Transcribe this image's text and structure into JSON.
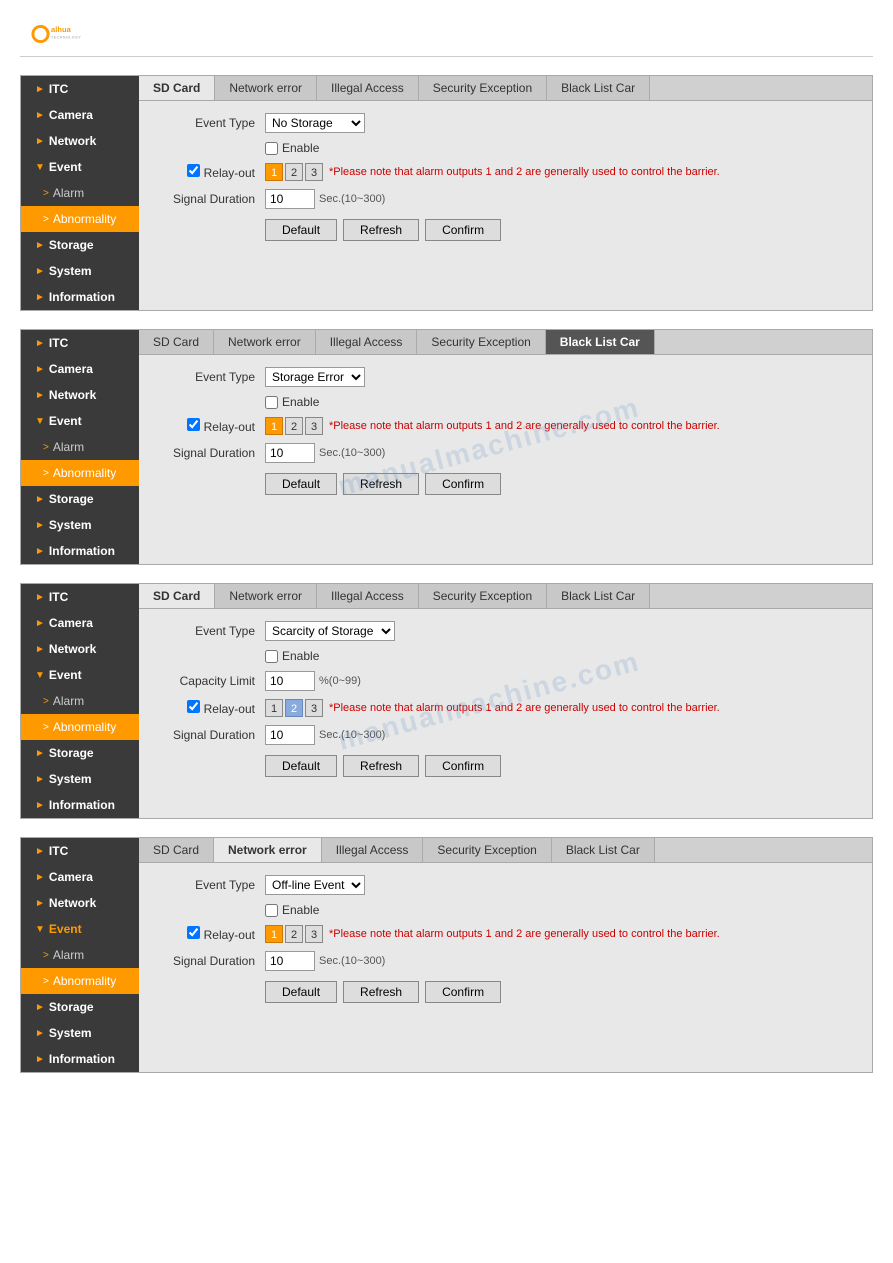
{
  "logo": {
    "alt": "Dahua Technology"
  },
  "panels": [
    {
      "id": "panel1",
      "tabs": [
        {
          "label": "SD Card",
          "active": false
        },
        {
          "label": "Network error",
          "active": false
        },
        {
          "label": "Illegal Access",
          "active": false
        },
        {
          "label": "Security Exception",
          "active": false
        },
        {
          "label": "Black List Car",
          "active": false
        }
      ],
      "activeTab": "SD Card",
      "sidebar": [
        {
          "label": "ITC",
          "type": "section",
          "arrow": "►"
        },
        {
          "label": "Camera",
          "type": "section",
          "arrow": "►"
        },
        {
          "label": "Network",
          "type": "section",
          "arrow": "►"
        },
        {
          "label": "Event",
          "type": "section",
          "arrow": "▼"
        },
        {
          "label": "Alarm",
          "type": "sub",
          "arrow": ">"
        },
        {
          "label": "Abnormality",
          "type": "sub-active",
          "arrow": ">"
        },
        {
          "label": "Storage",
          "type": "section",
          "arrow": "►"
        },
        {
          "label": "System",
          "type": "section",
          "arrow": "►"
        },
        {
          "label": "Information",
          "type": "section",
          "arrow": "►"
        }
      ],
      "form": {
        "eventTypeLabel": "Event Type",
        "eventTypeValue": "No Storage",
        "eventTypeOptions": [
          "No Storage",
          "Storage Error",
          "Scarcity of Storage Space",
          "Off-line Event"
        ],
        "enableLabel": "Enable",
        "enableChecked": false,
        "relayOutLabel": "Relay-out",
        "relayBtns": [
          "1",
          "2",
          "3"
        ],
        "relaySelected": 0,
        "relayNote": "*Please note that alarm outputs 1 and 2 are generally used to control the barrier.",
        "signalDurationLabel": "Signal Duration",
        "signalDurationValue": "10",
        "signalDurationHint": "Sec.(10~300)",
        "defaultBtn": "Default",
        "refreshBtn": "Refresh",
        "confirmBtn": "Confirm"
      },
      "watermark": false
    },
    {
      "id": "panel2",
      "tabs": [
        {
          "label": "SD Card",
          "active": false
        },
        {
          "label": "Network error",
          "active": false
        },
        {
          "label": "Illegal Access",
          "active": false
        },
        {
          "label": "Security Exception",
          "active": false
        },
        {
          "label": "Black List Car",
          "active": true
        }
      ],
      "activeTab": "Black List Car",
      "sidebar": [
        {
          "label": "ITC",
          "type": "section",
          "arrow": "►"
        },
        {
          "label": "Camera",
          "type": "section",
          "arrow": "►"
        },
        {
          "label": "Network",
          "type": "section",
          "arrow": "►"
        },
        {
          "label": "Event",
          "type": "section",
          "arrow": "▼"
        },
        {
          "label": "Alarm",
          "type": "sub",
          "arrow": ">"
        },
        {
          "label": "Abnormality",
          "type": "sub-active",
          "arrow": ">"
        },
        {
          "label": "Storage",
          "type": "section",
          "arrow": "►"
        },
        {
          "label": "System",
          "type": "section",
          "arrow": "►"
        },
        {
          "label": "Information",
          "type": "section",
          "arrow": "►"
        }
      ],
      "form": {
        "eventTypeLabel": "Event Type",
        "eventTypeValue": "Storage Error",
        "eventTypeOptions": [
          "No Storage",
          "Storage Error",
          "Scarcity of Storage Space",
          "Off-line Event"
        ],
        "enableLabel": "Enable",
        "enableChecked": false,
        "relayOutLabel": "Relay-out",
        "relayBtns": [
          "1",
          "2",
          "3"
        ],
        "relaySelected": 0,
        "relayNote": "*Please note that alarm outputs 1 and 2 are generally used to control the barrier.",
        "signalDurationLabel": "Signal Duration",
        "signalDurationValue": "10",
        "signalDurationHint": "Sec.(10~300)",
        "defaultBtn": "Default",
        "refreshBtn": "Refresh",
        "confirmBtn": "Confirm"
      },
      "watermark": true,
      "watermarkText": "manualmachine.com"
    },
    {
      "id": "panel3",
      "tabs": [
        {
          "label": "SD Card",
          "active": false
        },
        {
          "label": "Network error",
          "active": false
        },
        {
          "label": "Illegal Access",
          "active": false
        },
        {
          "label": "Security Exception",
          "active": false
        },
        {
          "label": "Black List Car",
          "active": false
        }
      ],
      "activeTab": "SD Card",
      "sidebar": [
        {
          "label": "ITC",
          "type": "section",
          "arrow": "►"
        },
        {
          "label": "Camera",
          "type": "section",
          "arrow": "►"
        },
        {
          "label": "Network",
          "type": "section",
          "arrow": "►"
        },
        {
          "label": "Event",
          "type": "section",
          "arrow": "▼"
        },
        {
          "label": "Alarm",
          "type": "sub",
          "arrow": ">"
        },
        {
          "label": "Abnormality",
          "type": "sub-active",
          "arrow": ">"
        },
        {
          "label": "Storage",
          "type": "section",
          "arrow": "►"
        },
        {
          "label": "System",
          "type": "section",
          "arrow": "►"
        },
        {
          "label": "Information",
          "type": "section",
          "arrow": "►"
        }
      ],
      "form": {
        "eventTypeLabel": "Event Type",
        "eventTypeValue": "Scarcity of Storage Sp.",
        "eventTypeOptions": [
          "No Storage",
          "Storage Error",
          "Scarcity of Storage Space",
          "Off-line Event"
        ],
        "enableLabel": "Enable",
        "enableChecked": false,
        "capacityLimitLabel": "Capacity Limit",
        "capacityLimitValue": "10",
        "capacityLimitHint": "%(0~99)",
        "relayOutLabel": "Relay-out",
        "relayBtns": [
          "1",
          "2",
          "3"
        ],
        "relaySelected": 1,
        "relayNote": "*Please note that alarm outputs 1 and 2 are generally used to control the barrier.",
        "signalDurationLabel": "Signal Duration",
        "signalDurationValue": "10",
        "signalDurationHint": "Sec.(10~300)",
        "defaultBtn": "Default",
        "refreshBtn": "Refresh",
        "confirmBtn": "Confirm"
      },
      "watermark": true,
      "watermarkText": "manualmachine.com"
    },
    {
      "id": "panel4",
      "tabs": [
        {
          "label": "SD Card",
          "active": false
        },
        {
          "label": "Network error",
          "active": true
        },
        {
          "label": "Illegal Access",
          "active": false
        },
        {
          "label": "Security Exception",
          "active": false
        },
        {
          "label": "Black List Car",
          "active": false
        }
      ],
      "activeTab": "Network error",
      "sidebar": [
        {
          "label": "ITC",
          "type": "section",
          "arrow": "►"
        },
        {
          "label": "Camera",
          "type": "section",
          "arrow": "►"
        },
        {
          "label": "Network",
          "type": "section",
          "arrow": "►"
        },
        {
          "label": "Event",
          "type": "section",
          "arrow": "▼"
        },
        {
          "label": "Alarm",
          "type": "sub",
          "arrow": ">"
        },
        {
          "label": "Abnormality",
          "type": "sub-active",
          "arrow": ">"
        },
        {
          "label": "Storage",
          "type": "section",
          "arrow": "►"
        },
        {
          "label": "System",
          "type": "section",
          "arrow": "►"
        },
        {
          "label": "Information",
          "type": "section",
          "arrow": "►"
        }
      ],
      "form": {
        "eventTypeLabel": "Event Type",
        "eventTypeValue": "Off-line Event",
        "eventTypeOptions": [
          "No Storage",
          "Storage Error",
          "Scarcity of Storage Space",
          "Off-line Event"
        ],
        "enableLabel": "Enable",
        "enableChecked": false,
        "relayOutLabel": "Relay-out",
        "relayBtns": [
          "1",
          "2",
          "3"
        ],
        "relaySelected": 0,
        "relayNote": "*Please note that alarm outputs 1 and 2 are generally used to control the barrier.",
        "signalDurationLabel": "Signal Duration",
        "signalDurationValue": "10",
        "signalDurationHint": "Sec.(10~300)",
        "defaultBtn": "Default",
        "refreshBtn": "Refresh",
        "confirmBtn": "Confirm"
      },
      "watermark": false
    }
  ]
}
